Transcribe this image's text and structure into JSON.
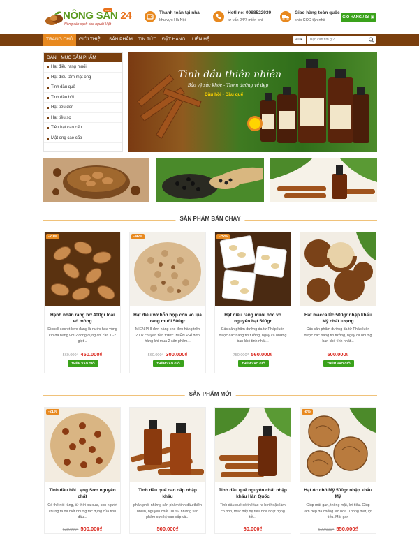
{
  "header": {
    "logo_brand_a": "NÔNG SẢN ",
    "logo_brand_b": "24",
    "logo_badge": ".com",
    "logo_tagline": "Nông sản sạch cho người Việt",
    "info": [
      {
        "icon": "wallet-icon",
        "title": "Thanh toán tại nhà",
        "sub": "khu vực Hà Nội"
      },
      {
        "icon": "phone-icon",
        "title": "Hotline: 0988522939",
        "sub": "tư vấn 24/7 miễn phí"
      },
      {
        "icon": "truck-icon",
        "title": "Giao hàng toàn quốc",
        "sub": "ship COD tận nhà"
      }
    ],
    "cart_label": "GIỎ HÀNG / 0đ"
  },
  "nav": {
    "items": [
      "TRANG CHỦ",
      "GIỚI THIỆU",
      "SẢN PHẨM",
      "TIN TỨC",
      "ĐẶT HÀNG",
      "LIÊN HỆ"
    ],
    "active_index": 0,
    "filter_value": "All",
    "search_placeholder": "Bạn cần tìm gì?"
  },
  "sidebar": {
    "title": "DANH MỤC SẢN PHẨM",
    "items": [
      "Hạt điều rang muối",
      "Hạt điều tẩm mật ong",
      "Tinh dầu quế",
      "Tinh dầu hồi",
      "Hạt tiêu đen",
      "Hạt tiêu sọ",
      "Tiêu hạt cao cấp",
      "Mật ong cao cấp"
    ]
  },
  "banner": {
    "title": "Tinh dầu thiên nhiên",
    "subtitle": "Bảo vệ sức khỏe - Thơm dưỡng vẻ đẹp",
    "subtitle2": "Dầu hồi - Dầu quế"
  },
  "sections": {
    "best_title": "SẢN PHẨM BÁN CHẠY",
    "new_title": "SẢN PHẨM MỚI"
  },
  "add_label": "THÊM VÀO GIỎ",
  "best_products": [
    {
      "discount": "-20%",
      "name": "Hạnh nhân rang bơ 400gr loại vỏ mỏng",
      "desc": "Dionell secret love đang là nước hoa vùng kín đa năng với 2 công dụng chỉ cần 1 -2 giọt...",
      "old_price": "560.000₫",
      "price": "450.000₫"
    },
    {
      "discount": "-46%",
      "name": "Hạt điều vỡ hỗn hợp còn vỏ lụa rang muối 500gr",
      "desc": "MIỄN PHÍ đơn hàng cho đơn hàng trên 200k chuyển tiền trước. MIỄN PHÍ đơn hàng khi mua 2 sản phẩm...",
      "old_price": "560.000₫",
      "price": "300.000₫"
    },
    {
      "discount": "-25%",
      "name": "Hạt điều rang muối bóc vỏ nguyên hạt 500gr",
      "desc": "Các sản phẩm dưỡng da từ Pháp luôn được các nàng tin tưởng, ngay cả những bạn khó tính nhất...",
      "old_price": "750.000₫",
      "price": "560.000₫"
    },
    {
      "discount": "",
      "name": "Hạt macca Úc 500gr nhập khẩu Mỹ chất lượng",
      "desc": "Các sản phẩm dưỡng da từ Pháp luôn được các nàng tin tưởng, ngay cả những bạn khó tính nhất...",
      "old_price": "",
      "price": "500.000₫"
    }
  ],
  "new_products": [
    {
      "discount": "-21%",
      "name": "Tinh dầu hồi Lạng Sơn nguyên chất",
      "desc": "Có thể nói rằng, từ thời xa xưa, con người chúng ta đã biết những tác dụng của tinh dầu...",
      "old_price": "630.000₫",
      "price": "500.000₫"
    },
    {
      "discount": "",
      "name": "Tinh dầu quế cao cấp nhập khẩu",
      "desc": "phân phối những sản phẩm tinh dầu thiên nhiên, nguyên chất 100%, những sản phẩm cực kỳ cao cấp và...",
      "old_price": "",
      "price": "500.000₫"
    },
    {
      "discount": "",
      "name": "Tinh dầu quế nguyên chất nhập khẩu Hàn Quốc",
      "desc": "Tinh dầu quế có thể tạo ra hơi hoặc làm co bóp, thúc đẩy hệ tiêu hóa hoạt động tốt...",
      "old_price": "",
      "price": "60.000₫"
    },
    {
      "discount": "-8%",
      "name": "Hạt óc chó Mỹ 500gr nhập khẩu Mỹ",
      "desc": "Giúp mát gan, thông mật, lợi tiểu. Giúp làm đẹp da chống lão hóa. Thông mát, lợi tiểu. Mát gan",
      "old_price": "600.000₫",
      "price": "550.000₫"
    }
  ],
  "colors": {
    "nav_bg": "#7a3f0e",
    "accent_orange": "#e8891f",
    "cart_green": "#3aa21b",
    "price_red": "#d9261c"
  }
}
